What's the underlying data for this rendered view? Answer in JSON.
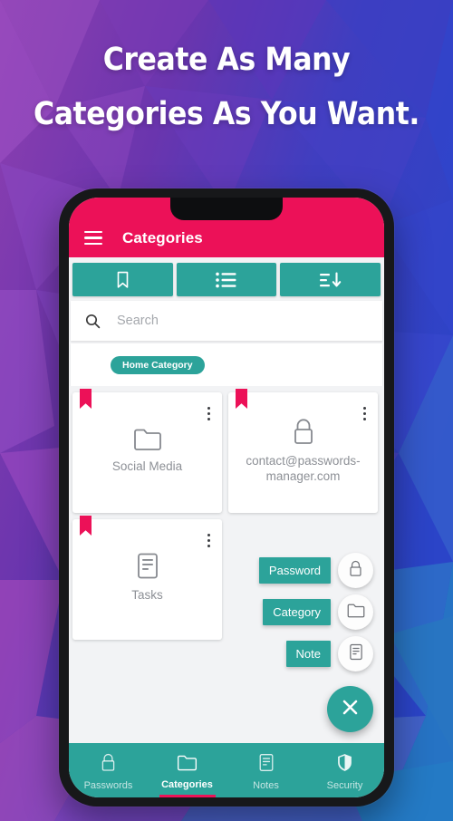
{
  "headline": {
    "line1": "Create As Many",
    "line2": "Categories As You Want."
  },
  "colors": {
    "primary_pink": "#EC1158",
    "primary_teal": "#2CA39A",
    "screen_bg": "#f2f3f5",
    "card_bg": "#ffffff",
    "card_label": "#8d9096"
  },
  "appbar": {
    "menu_icon": "hamburger-menu-icon",
    "title": "Categories"
  },
  "toolbar": {
    "buttons": [
      {
        "name": "bookmark-icon",
        "label": "Bookmark"
      },
      {
        "name": "list-icon",
        "label": "List"
      },
      {
        "name": "sort-descending-icon",
        "label": "Sort"
      }
    ]
  },
  "search": {
    "icon": "search-icon",
    "value": "",
    "placeholder": "Search"
  },
  "chips": [
    {
      "label": "Home Category"
    }
  ],
  "cards": [
    {
      "label": "Social Media",
      "icon": "folder-icon",
      "bookmarked": true,
      "menu": "more-vertical-icon"
    },
    {
      "label": "contact@passwords-manager.com",
      "icon": "lock-icon",
      "bookmarked": true,
      "menu": "more-vertical-icon"
    },
    {
      "label": "Tasks",
      "icon": "note-icon",
      "bookmarked": true,
      "menu": "more-vertical-icon"
    }
  ],
  "speed_dial": {
    "expanded": true,
    "main_icon": "close-icon",
    "items": [
      {
        "label": "Password",
        "icon": "lock-icon"
      },
      {
        "label": "Category",
        "icon": "folder-icon"
      },
      {
        "label": "Note",
        "icon": "note-icon"
      }
    ]
  },
  "bottom_nav": {
    "active_index": 1,
    "items": [
      {
        "label": "Passwords",
        "icon": "lock-icon"
      },
      {
        "label": "Categories",
        "icon": "folder-icon"
      },
      {
        "label": "Notes",
        "icon": "note-icon"
      },
      {
        "label": "Security",
        "icon": "shield-icon"
      }
    ]
  }
}
